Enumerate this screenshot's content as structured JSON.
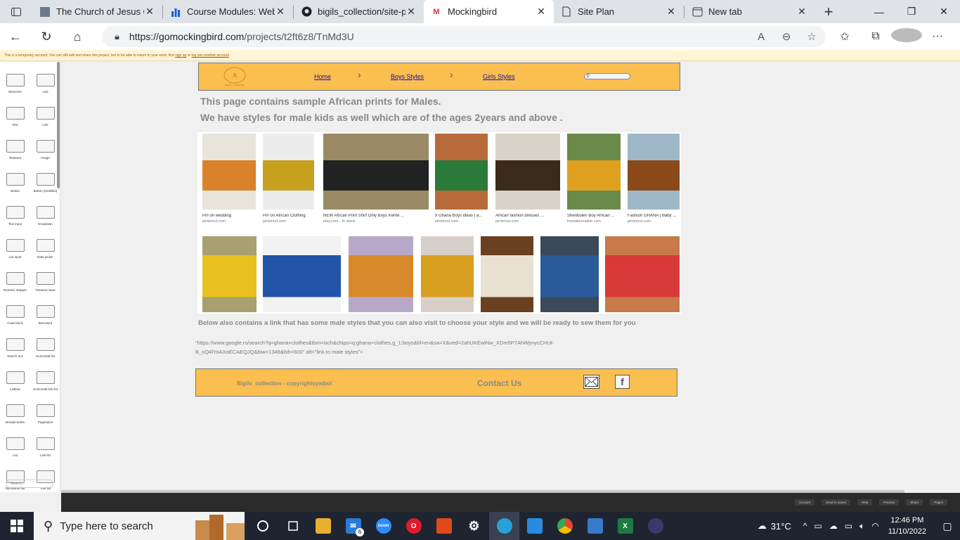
{
  "browser": {
    "tabs": [
      {
        "title": "The Church of Jesus Ch",
        "favicon": "church-favicon",
        "active": false
      },
      {
        "title": "Course Modules: Web",
        "favicon": "chart-favicon",
        "active": false
      },
      {
        "title": "bigils_collection/site-p",
        "favicon": "github-favicon",
        "active": false
      },
      {
        "title": "Mockingbird",
        "favicon": "M",
        "active": true
      },
      {
        "title": "Site Plan",
        "favicon": "doc-favicon",
        "active": false
      },
      {
        "title": "New tab",
        "favicon": "newtab-favicon",
        "active": false
      }
    ],
    "url_host": "https://gomockingbird.com",
    "url_path": "/projects/t2ft6z8/TnMd3U",
    "close_glyph": "✕",
    "new_tab_glyph": "+"
  },
  "notice": {
    "text": "This is a temporary account. You can still edit and share this project, but to be able to return to your work, first",
    "sign_up": "sign up",
    "or": "or",
    "login": "log into another account"
  },
  "palette": {
    "items": [
      "Welcome",
      "Link",
      "Text",
      "Link",
      "Textarea",
      "Image",
      "Button",
      "Button (multiline)",
      "Text input",
      "Dropdown",
      "List input",
      "Date picker",
      "Numeric stepper",
      "Textarea input",
      "Code block",
      "Borrowed",
      "Search box",
      "Horizontal list",
      "Linkbar",
      "Horizontal link list",
      "Breadcrumbs",
      "Pagination",
      "List",
      "Link list",
      "Numbered list",
      "Tree list",
      "Bulleted list",
      "Radio buttons"
    ],
    "search_placeholder": "Search..."
  },
  "mockup": {
    "logo_alt": "Bigils_collection",
    "nav": {
      "home": "Home",
      "boys": "Boys Styles",
      "girls": "Girls Styles"
    },
    "headline1": "This page contains sample African prints for Males.",
    "headline2": "We have  styles for male kids as well which are of  the ages 2years and above .",
    "gallery_row1": [
      {
        "caption": "Pin on wedding",
        "source": "pinterest.com",
        "color": "#e8e4dc",
        "accent": "#d9822b"
      },
      {
        "caption": "Pin on African Clothing",
        "source": "pinterest.com",
        "color": "#ececec",
        "accent": "#c8a020"
      },
      {
        "caption": "NEW African Print Shirt Only Boys Kente ...",
        "source": "etsy.com · In stock",
        "color": "#9a8a66",
        "accent": "#222222"
      },
      {
        "caption": "9 Ghana Boys ideas | a...",
        "source": "pinterest.com",
        "color": "#b86b3a",
        "accent": "#2a7a3a"
      },
      {
        "caption": "African fashion dresses ...",
        "source": "pinterest.com",
        "color": "#d8d2c8",
        "accent": "#3a2a1a"
      },
      {
        "caption": "Shenbolen Boy African ...",
        "source": "foretabionaline.com",
        "color": "#6a8a4a",
        "accent": "#e0a020"
      },
      {
        "caption": "Fashion GHANA | Baby ...",
        "source": "pinterest.com",
        "color": "#9eb8c8",
        "accent": "#8a4a1a"
      }
    ],
    "gallery_row2": [
      {
        "color": "#a8a070",
        "accent": "#e8c020"
      },
      {
        "color": "#f2f2f2",
        "accent": "#2255aa"
      },
      {
        "color": "#b8a8c8",
        "accent": "#d88a2a"
      },
      {
        "color": "#d8d0c8",
        "accent": "#d8a020"
      },
      {
        "color": "#6a4020",
        "accent": "#e8e0d0"
      },
      {
        "color": "#3a4a5a",
        "accent": "#2a5a9a"
      },
      {
        "color": "#c87a4a",
        "accent": "#d83a3a"
      }
    ],
    "paragraph": "Below also contains a link that has some male styles that you can also visit to choose your style and we will be ready to sew them for you",
    "link_code": "\"https://www.google.ru/search?q=ghana+clothes&tbm=isch&chips=q:ghana+clothes,g_1:boys&hl=en&sa=X&ved=2ahUKEwiNw_XDm5P7AhWjmycCHUt-B_oQ4lYoAXoECAEQJQ&biw=1349&bih=600\" alt=\"link to male styles\">",
    "footer": {
      "copyright": "Bigils_collection - copyrightsymbol",
      "contact": "Contact Us"
    }
  },
  "statusbar": [
    "Account",
    "Send to Jones",
    "Help",
    "Preview",
    "Share",
    "Pages"
  ],
  "taskbar": {
    "search_placeholder": "Type here to search",
    "mail_badge": "6",
    "weather": "31°C",
    "time": "12:46 PM",
    "date": "11/10/2022"
  }
}
